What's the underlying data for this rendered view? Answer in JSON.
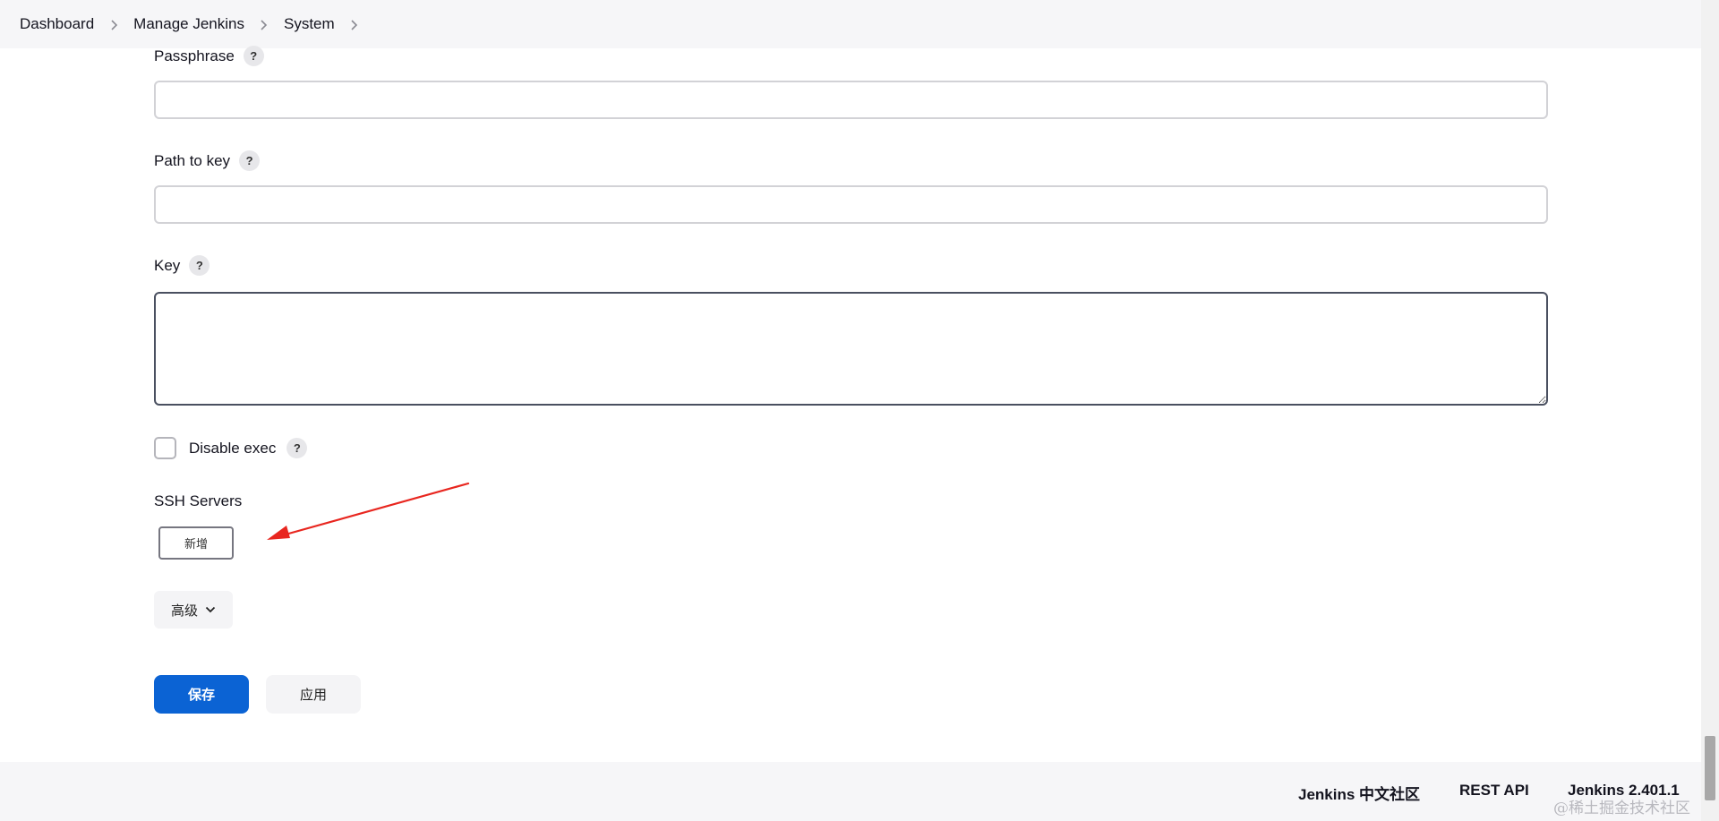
{
  "breadcrumb": {
    "items": [
      "Dashboard",
      "Manage Jenkins",
      "System"
    ]
  },
  "form": {
    "passphrase_label": "Passphrase",
    "passphrase_value": "",
    "path_to_key_label": "Path to key",
    "path_to_key_value": "",
    "key_label": "Key",
    "key_value": "",
    "help_symbol": "?",
    "disable_exec_label": "Disable exec",
    "disable_exec_checked": false,
    "ssh_servers_label": "SSH Servers",
    "add_button_label": "新增",
    "advanced_label": "高级",
    "save_label": "保存",
    "apply_label": "应用"
  },
  "footer": {
    "community_link": "Jenkins 中文社区",
    "rest_api_link": "REST API",
    "version_link": "Jenkins 2.401.1",
    "watermark": "@稀土掘金技术社区"
  },
  "colors": {
    "primary_button": "#0b63d4",
    "annotation_arrow": "#e8261f",
    "bar_background": "#f6f6f8"
  },
  "icons": {
    "breadcrumb_separator": "chevron-right-icon",
    "advanced_toggle": "chevron-down-icon",
    "help": "help-icon"
  }
}
